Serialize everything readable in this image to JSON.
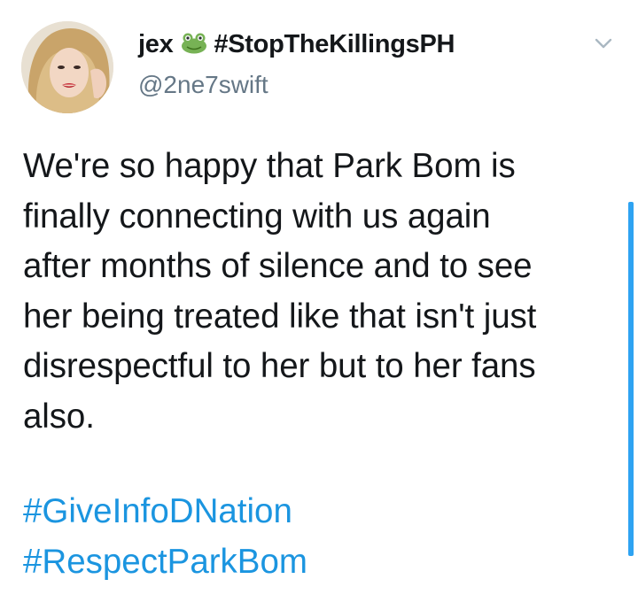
{
  "tweet": {
    "display_name": "jex",
    "name_emoji": "frog-icon",
    "name_hashtag": "#StopTheKillingsPH",
    "handle": "@2ne7swift",
    "text_lines": [
      "We're so happy that Park Bom is",
      "finally connecting with us again",
      "after months of silence and to see",
      "her being treated like that isn't just",
      "disrespectful to her but to her fans",
      "also."
    ],
    "hashtags": [
      "#GiveInfoDNation",
      "#RespectParkBom"
    ]
  },
  "colors": {
    "text": "#14171a",
    "secondary": "#657786",
    "link": "#1b95e0",
    "scrollbar": "#2ea3f2"
  }
}
